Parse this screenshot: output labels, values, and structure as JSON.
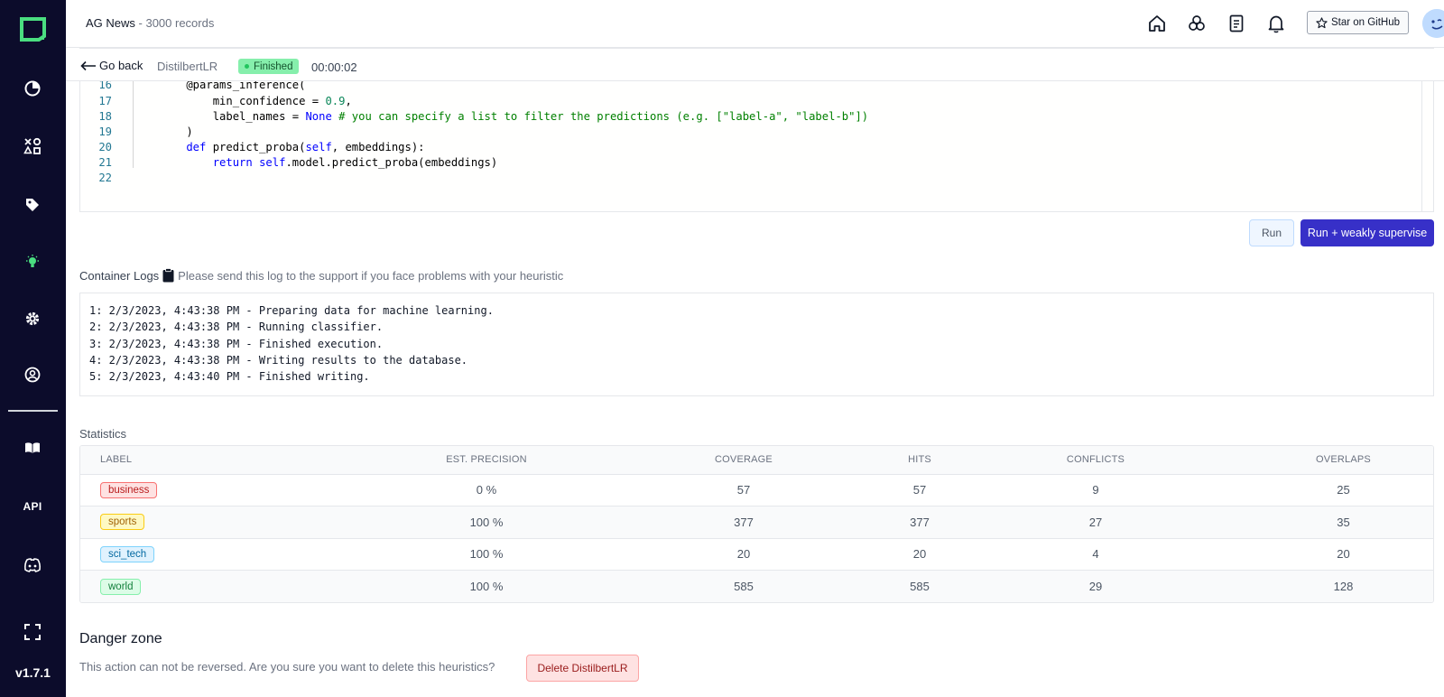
{
  "sidebar": {
    "logo": "logo-square-icon",
    "items": [
      {
        "name": "overview",
        "icon": "pie-chart-icon"
      },
      {
        "name": "data-browser",
        "icon": "shapes-icon"
      },
      {
        "name": "labeling",
        "icon": "tag-icon"
      },
      {
        "name": "heuristics",
        "icon": "lightbulb-icon"
      },
      {
        "name": "settings",
        "icon": "gear-icon"
      },
      {
        "name": "users",
        "icon": "user-circle-icon"
      },
      {
        "name": "docs",
        "icon": "book-icon"
      },
      {
        "name": "api",
        "icon": "api-icon",
        "label": "API"
      },
      {
        "name": "discord",
        "icon": "discord-icon"
      },
      {
        "name": "fullscreen",
        "icon": "fullscreen-icon"
      }
    ],
    "version": "v1.7.1",
    "active_color": "#4ade80"
  },
  "header": {
    "project_name": "AG News",
    "separator": " - ",
    "record_count": "3000 records",
    "github_label": "Star on GitHub"
  },
  "subheader": {
    "back_label": "Go back",
    "heuristic_name": "DistilbertLR",
    "status": "Finished",
    "duration": "00:00:02"
  },
  "code": {
    "lines": [
      {
        "n": "16",
        "parts": [
          [
            "",
            "    @params_inference("
          ]
        ]
      },
      {
        "n": "17",
        "parts": [
          [
            "",
            "        min_confidence = "
          ],
          [
            "num",
            "0.9"
          ],
          [
            "",
            ","
          ]
        ]
      },
      {
        "n": "18",
        "parts": [
          [
            "",
            "        label_names = "
          ],
          [
            "kw",
            "None"
          ],
          [
            "cm",
            " # you can specify a list to filter the predictions (e.g. [\"label-a\", \"label-b\"])"
          ]
        ]
      },
      {
        "n": "19",
        "parts": [
          [
            "",
            "    )"
          ]
        ]
      },
      {
        "n": "20",
        "parts": [
          [
            "kw",
            "    def"
          ],
          [
            "",
            " predict_proba("
          ],
          [
            "kw",
            "self"
          ],
          [
            "",
            ", embeddings):"
          ]
        ]
      },
      {
        "n": "21",
        "parts": [
          [
            "kw",
            "        return"
          ],
          [
            "",
            " "
          ],
          [
            "kw",
            "self"
          ],
          [
            "",
            ".model.predict_proba(embeddings)"
          ]
        ]
      },
      {
        "n": "22",
        "parts": [
          [
            "",
            ""
          ]
        ]
      }
    ]
  },
  "actions": {
    "run_label": "Run",
    "run_ws_label": "Run + weakly supervise"
  },
  "logs": {
    "title": "Container Logs",
    "hint": "Please send this log to the support if you face problems with your heuristic",
    "lines": [
      "1: 2/3/2023, 4:43:38 PM - Preparing data for machine learning.",
      "2: 2/3/2023, 4:43:38 PM - Running classifier.",
      "3: 2/3/2023, 4:43:38 PM - Finished execution.",
      "4: 2/3/2023, 4:43:38 PM - Writing results to the database.",
      "5: 2/3/2023, 4:43:40 PM - Finished writing."
    ]
  },
  "statistics": {
    "title": "Statistics",
    "columns": [
      "LABEL",
      "EST. PRECISION",
      "COVERAGE",
      "HITS",
      "CONFLICTS",
      "OVERLAPS"
    ],
    "rows": [
      {
        "label": "business",
        "color": "#fee2e2",
        "border": "#f87171",
        "text": "#b91c1c",
        "precision": "0 %",
        "coverage": "57",
        "hits": "57",
        "conflicts": "9",
        "overlaps": "25"
      },
      {
        "label": "sports",
        "color": "#fef9c3",
        "border": "#facc15",
        "text": "#a16207",
        "precision": "100 %",
        "coverage": "377",
        "hits": "377",
        "conflicts": "27",
        "overlaps": "35"
      },
      {
        "label": "sci_tech",
        "color": "#e0f2fe",
        "border": "#7dd3fc",
        "text": "#0369a1",
        "precision": "100 %",
        "coverage": "20",
        "hits": "20",
        "conflicts": "4",
        "overlaps": "20"
      },
      {
        "label": "world",
        "color": "#dcfce7",
        "border": "#86efac",
        "text": "#15803d",
        "precision": "100 %",
        "coverage": "585",
        "hits": "585",
        "conflicts": "29",
        "overlaps": "128"
      }
    ]
  },
  "danger_zone": {
    "title": "Danger zone",
    "text": "This action can not be reversed. Are you sure you want to delete this heuristics?",
    "button_label": "Delete DistilbertLR"
  }
}
